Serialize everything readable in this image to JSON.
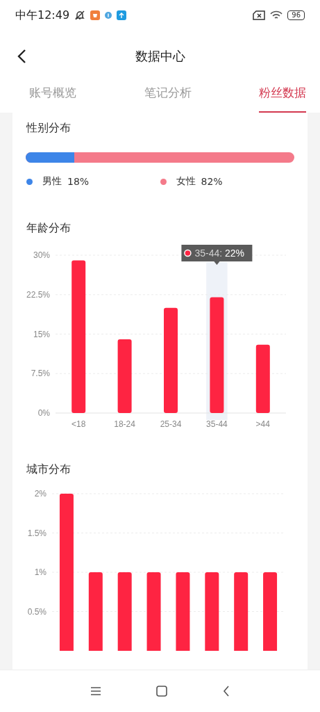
{
  "status_bar": {
    "time": "中午12:49",
    "battery": "96"
  },
  "header": {
    "title": "数据中心"
  },
  "tabs": [
    {
      "label": "账号概览",
      "selected": false
    },
    {
      "label": "笔记分析",
      "selected": false
    },
    {
      "label": "粉丝数据",
      "selected": true
    }
  ],
  "gender": {
    "title": "性别分布",
    "level": 0.18,
    "legend": [
      {
        "label": "男性",
        "value": "18%",
        "color": "#3d85e8"
      },
      {
        "label": "女性",
        "value": "82%",
        "color": "#f47a8a"
      }
    ]
  },
  "age": {
    "title": "年龄分布",
    "chart_data": {
      "type": "bar",
      "categories": [
        "<18",
        "18-24",
        "25-34",
        "35-44",
        ">44"
      ],
      "values": [
        29,
        14,
        20,
        22,
        13
      ],
      "ylim": [
        0,
        30
      ],
      "yticks": [
        {
          "value": 0,
          "label": "0%"
        },
        {
          "value": 7.5,
          "label": "7.5%"
        },
        {
          "value": 15,
          "label": "15%"
        },
        {
          "value": 22.5,
          "label": "22.5%"
        },
        {
          "value": 30,
          "label": "30%"
        }
      ],
      "grid": true
    },
    "tooltip": {
      "category": "35-44",
      "delimiter": ":",
      "value": "22%"
    }
  },
  "city": {
    "title": "城市分布",
    "chart_data": {
      "type": "bar",
      "values": [
        2,
        1,
        1,
        1,
        1,
        1,
        1,
        1
      ],
      "ylim": [
        0,
        2
      ],
      "grid": true,
      "yticks": [
        {
          "value": 0.5,
          "label": "0.5%"
        },
        {
          "value": 1,
          "label": "1%"
        },
        {
          "value": 1.5,
          "label": "1.5%"
        },
        {
          "value": 2,
          "label": "2%"
        }
      ]
    }
  }
}
